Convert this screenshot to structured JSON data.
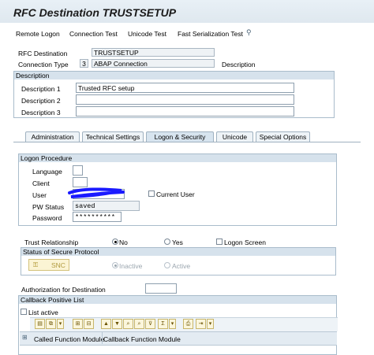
{
  "page": {
    "title": "RFC Destination TRUSTSETUP"
  },
  "toolbar": {
    "items": [
      "Remote Logon",
      "Connection Test",
      "Unicode Test",
      "Fast Serialization Test"
    ]
  },
  "header": {
    "rfc_destination_label": "RFC Destination",
    "rfc_destination_value": "TRUSTSETUP",
    "connection_type_label": "Connection Type",
    "connection_type_code": "3",
    "connection_type_text": "ABAP Connection",
    "description_label": "Description"
  },
  "description": {
    "section_title": "Description",
    "d1_label": "Description 1",
    "d1_value": "Trusted RFC setup",
    "d2_label": "Description 2",
    "d2_value": "",
    "d3_label": "Description 3",
    "d3_value": ""
  },
  "tabs": [
    "Administration",
    "Technical Settings",
    "Logon & Security",
    "Unicode",
    "Special Options"
  ],
  "logon": {
    "section_title": "Logon Procedure",
    "language_label": "Language",
    "client_label": "Client",
    "user_label": "User",
    "current_user_label": "Current User",
    "pw_status_label": "PW Status",
    "pw_status_value": "saved",
    "password_label": "Password",
    "password_value": "**********"
  },
  "trust": {
    "label": "Trust Relationship",
    "no_label": "No",
    "yes_label": "Yes",
    "logon_screen_label": "Logon Screen"
  },
  "secure": {
    "section_title": "Status of Secure Protocol",
    "snc_label": "SNC",
    "inactive_label": "Inactive",
    "active_label": "Active"
  },
  "auth": {
    "label": "Authorization for Destination",
    "value": ""
  },
  "callback": {
    "section_title": "Callback Positive List",
    "list_active_label": "List active",
    "col_called": "Called Function Module",
    "col_callback": "Callback Function Module"
  },
  "colors": {
    "section_bar": "#d6e2ec",
    "scribble": "#1a1aff"
  }
}
